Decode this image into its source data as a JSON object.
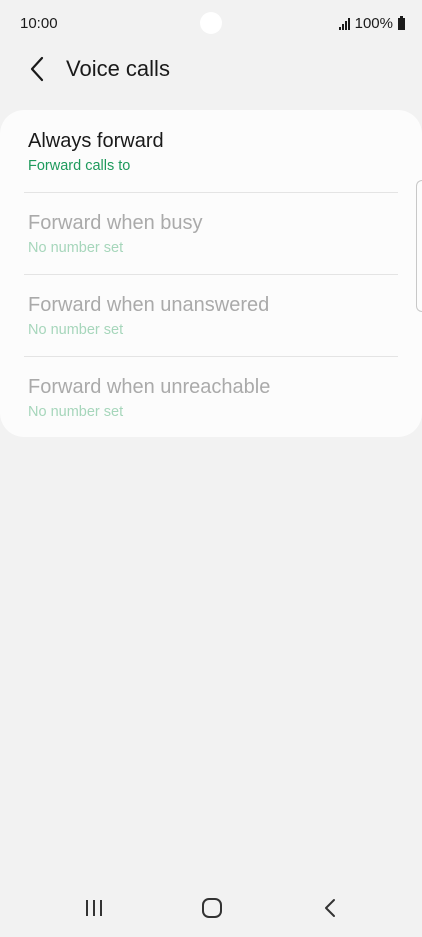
{
  "status_bar": {
    "time": "10:00",
    "battery": "100%"
  },
  "header": {
    "title": "Voice calls"
  },
  "forwarding_options": [
    {
      "title": "Always forward",
      "subtitle": "Forward calls to",
      "enabled": true
    },
    {
      "title": "Forward when busy",
      "subtitle": "No number set",
      "enabled": false
    },
    {
      "title": "Forward when unanswered",
      "subtitle": "No number set",
      "enabled": false
    },
    {
      "title": "Forward when unreachable",
      "subtitle": "No number set",
      "enabled": false
    }
  ],
  "colors": {
    "background": "#f2f2f2",
    "card": "#fcfcfc",
    "accent_green": "#1e9a5c",
    "disabled_text": "#aaaaaa",
    "disabled_green": "#a6d6bb"
  },
  "icons": {
    "back": "chevron-left-icon",
    "nav_recent": "recent-apps-icon",
    "nav_home": "home-icon",
    "nav_back": "nav-back-icon",
    "signal": "signal-icon",
    "battery": "battery-icon"
  }
}
